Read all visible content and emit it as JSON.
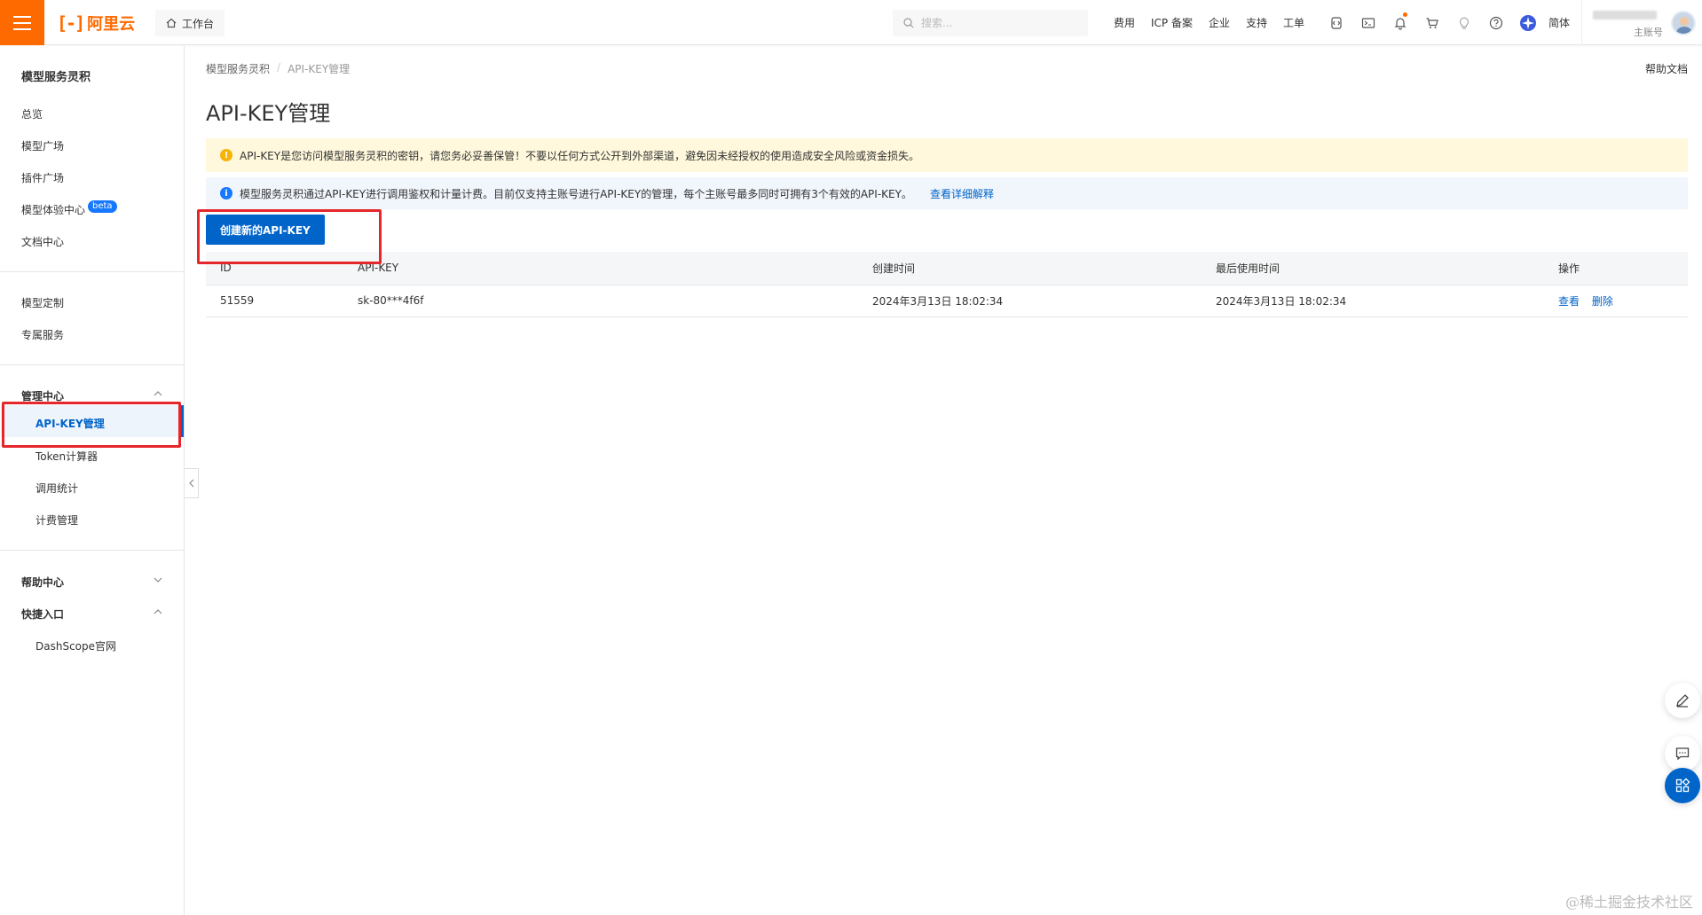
{
  "topbar": {
    "logo_text": "阿里云",
    "workbench": "工作台",
    "search_placeholder": "搜索...",
    "nav_links": [
      "费用",
      "ICP 备案",
      "企业",
      "支持",
      "工单"
    ],
    "icons": [
      "code-icon",
      "terminal-icon",
      "bell-icon",
      "cart-icon",
      "bulb-icon",
      "help-icon",
      "globe-icon"
    ],
    "language": "简体",
    "account_label": "主账号",
    "accent_color": "#ff6a00"
  },
  "sidebar": {
    "title": "模型服务灵积",
    "items_top": [
      "总览",
      "模型广场",
      "插件广场",
      "模型体验中心",
      "文档中心"
    ],
    "beta_badge": "beta",
    "items_mid": [
      "模型定制",
      "专属服务"
    ],
    "group_manage": "管理中心",
    "manage_items": [
      "API-KEY管理",
      "Token计算器",
      "调用统计",
      "计费管理"
    ],
    "group_help": "帮助中心",
    "group_quick": "快捷入口",
    "quick_items": [
      "DashScope官网"
    ]
  },
  "main": {
    "breadcrumb": [
      "模型服务灵积",
      "API-KEY管理"
    ],
    "help_doc": "帮助文档",
    "title": "API-KEY管理",
    "warning": "API-KEY是您访问模型服务灵积的密钥，请您务必妥善保管！不要以任何方式公开到外部渠道，避免因未经授权的使用造成安全风险或资金损失。",
    "info": "模型服务灵积通过API-KEY进行调用鉴权和计量计费。目前仅支持主账号进行API-KEY的管理，每个主账号最多同时可拥有3个有效的API-KEY。",
    "info_link": "查看详细解释",
    "create_button": "创建新的API-KEY",
    "table": {
      "columns": [
        "ID",
        "API-KEY",
        "创建时间",
        "最后使用时间",
        "操作"
      ],
      "rows": [
        {
          "id": "51559",
          "key": "sk-80***4f6f",
          "created": "2024年3月13日 18:02:34",
          "last_used": "2024年3月13日 18:02:34",
          "actions": [
            "查看",
            "删除"
          ]
        }
      ]
    }
  },
  "watermark": "@稀土掘金技术社区",
  "brand_blue": "#0064c8"
}
